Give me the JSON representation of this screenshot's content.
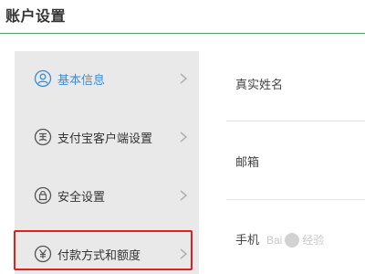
{
  "header": {
    "title": "账户设置"
  },
  "sidebar": {
    "items": [
      {
        "label": "基本信息",
        "icon": "user-icon",
        "active": true
      },
      {
        "label": "支付宝客户端设置",
        "icon": "payment-client-icon",
        "active": false
      },
      {
        "label": "安全设置",
        "icon": "lock-icon",
        "active": false
      },
      {
        "label": "付款方式和额度",
        "icon": "yen-icon",
        "active": false
      }
    ]
  },
  "content": {
    "rows": [
      {
        "label": "真实姓名"
      },
      {
        "label": "邮箱"
      },
      {
        "label": "手机"
      }
    ]
  },
  "watermark": {
    "text_a": "Bai",
    "text_b": "经验"
  },
  "colors": {
    "accent": "#3a8ed4",
    "highlight": "#e0201f",
    "header_rule": "#5a9f6a",
    "sidebar_bg": "#e9e9e9"
  }
}
